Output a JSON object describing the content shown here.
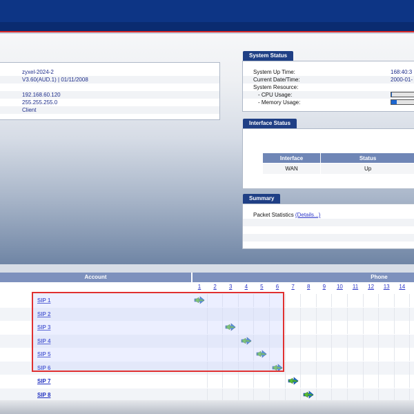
{
  "general_info": {
    "rows": [
      {
        "value": "zyxel-2024-2"
      },
      {
        "value": "V3.60(AUD.1) | 01/11/2008"
      },
      {
        "value": ""
      },
      {
        "value": "192.168.60.120"
      },
      {
        "value": "255.255.255.0"
      },
      {
        "value": "Client"
      }
    ]
  },
  "system_status": {
    "title": "System Status",
    "rows": [
      {
        "label": "System Up Time:",
        "value": "168:40:3"
      },
      {
        "label": "Current Date/Time:",
        "value": "2000-01-"
      },
      {
        "label": "System Resource:",
        "value": ""
      },
      {
        "label": "- CPU Usage:",
        "value": ""
      },
      {
        "label": "- Memory Usage:",
        "value": ""
      }
    ],
    "cpu_usage_fraction": 0.02,
    "memory_usage_fraction": 0.2
  },
  "interface_status": {
    "title": "Interface Status",
    "headers": [
      "Interface",
      "Status"
    ],
    "rows": [
      {
        "interface": "WAN",
        "status": "Up"
      }
    ]
  },
  "summary": {
    "title": "Summary",
    "label": "Packet Statistics",
    "link": "(Details...)"
  },
  "accounts": {
    "account_header": "Account",
    "phone_header": "Phone",
    "phone_numbers": [
      "1",
      "2",
      "3",
      "4",
      "5",
      "6",
      "7",
      "8",
      "9",
      "10",
      "11",
      "12",
      "13",
      "14"
    ],
    "rows": [
      {
        "name": "SIP 1",
        "phone": 1
      },
      {
        "name": "SIP 2",
        "phone": null
      },
      {
        "name": "SIP 3",
        "phone": 3
      },
      {
        "name": "SIP 4",
        "phone": 4
      },
      {
        "name": "SIP 5",
        "phone": 5
      },
      {
        "name": "SIP 6",
        "phone": 6
      },
      {
        "name": "SIP 7",
        "phone": 7
      },
      {
        "name": "SIP 8",
        "phone": 8
      }
    ]
  },
  "colors": {
    "header_blue": "#0d3585",
    "accent_red": "#d82828",
    "panel_title": "#1f3f85",
    "link": "#1f2fc0",
    "arrow_blue": "#1f7ad6",
    "arrow_green": "#5cc02a"
  },
  "icons": {
    "phone_mapping": "bidirectional-arrow-icon"
  }
}
